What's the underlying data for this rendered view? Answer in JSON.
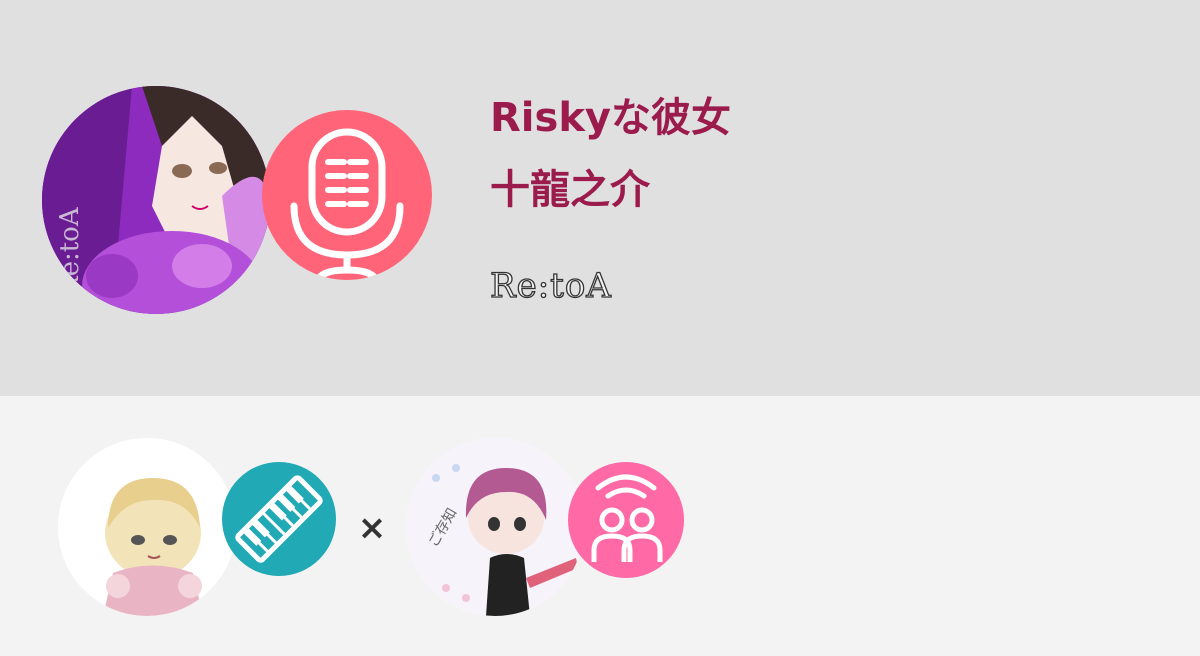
{
  "header": {
    "song_title": "Riskyな彼女",
    "artist": "十龍之介",
    "singer_name": "Re:toA"
  },
  "avatars": {
    "main_singer": {
      "icon": "singer-avatar",
      "watermark": "Re:toA"
    },
    "role_main": {
      "icon": "microphone-icon"
    },
    "collab_partner_a": {
      "icon": "chibi-avatar"
    },
    "role_partner_a": {
      "icon": "keyboard-icon"
    },
    "collab_partner_b": {
      "icon": "chibi-avatar"
    },
    "role_partner_b": {
      "icon": "chorus-icon"
    }
  },
  "collab": {
    "separator": "×"
  },
  "colors": {
    "title": "#9b1b4c",
    "mic_badge": "#ff6478",
    "keyboard_badge": "#22a9b6",
    "chorus_badge": "#ff69a6",
    "header_bg": "#e0e0e0",
    "footer_bg": "#f3f3f3"
  }
}
